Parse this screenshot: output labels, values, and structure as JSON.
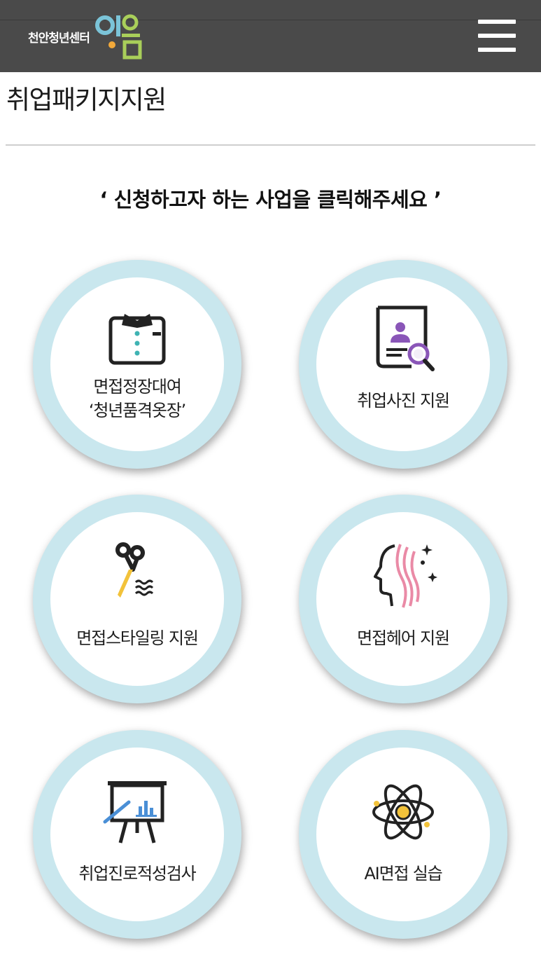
{
  "header": {
    "logo_text": "천안청년센터",
    "logo_mark": "이음",
    "menu_icon": "hamburger-menu-icon"
  },
  "page": {
    "title": "취업패키지지원",
    "instruction": "‘ 신청하고자 하는 사업을 클릭해주세요 ’"
  },
  "programs": [
    {
      "label_line1": "면접정장대여",
      "label_line2": "‘청년품격옷장’",
      "icon": "shirt-icon"
    },
    {
      "label_line1": "취업사진 지원",
      "icon": "photo-document-search-icon"
    },
    {
      "label_line1": "면접스타일링 지원",
      "icon": "scissors-comb-icon"
    },
    {
      "label_line1": "면접헤어 지원",
      "icon": "hair-profile-icon"
    },
    {
      "label_line1": "취업진로적성검사",
      "icon": "presentation-board-icon"
    },
    {
      "label_line1": "AI면접 실습",
      "icon": "atom-icon"
    }
  ],
  "colors": {
    "header_bg": "#4a4a4a",
    "circle_ring": "#c9e7ee",
    "accent_teal": "#3fb3b3",
    "accent_purple": "#8a56b8",
    "accent_blue": "#4a8fd6",
    "accent_yellow": "#f2c23a",
    "accent_pink": "#ea8aa6"
  }
}
